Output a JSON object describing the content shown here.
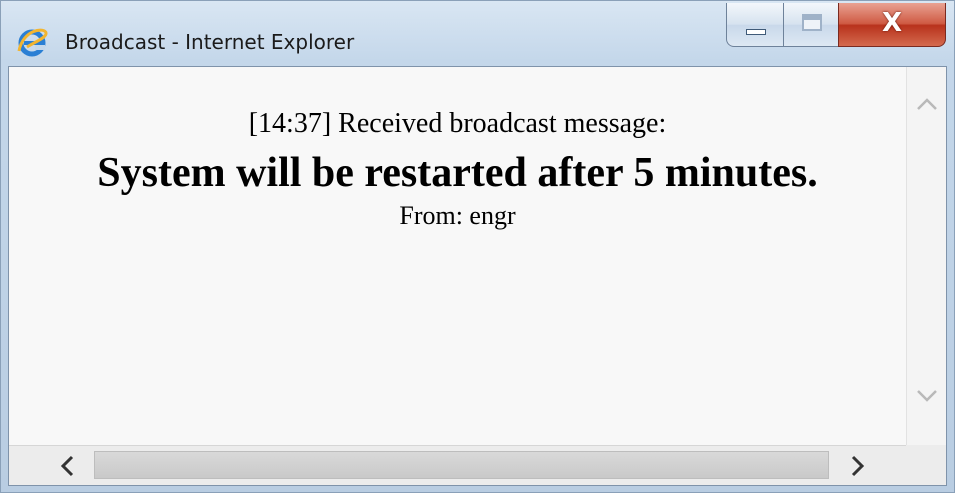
{
  "window": {
    "title": "Broadcast - Internet Explorer",
    "icon": "internet-explorer-icon",
    "caption_buttons": {
      "minimize_icon": "minimize-icon",
      "maximize_icon": "maximize-icon",
      "close_glyph": "X"
    }
  },
  "message": {
    "received_line": "[14:37] Received broadcast message:",
    "headline": "System will be restarted after 5 minutes.",
    "sender_line": "From: engr"
  },
  "scrollbars": {
    "up_arrow": "^",
    "down_arrow": "⌄",
    "left_arrow": "<",
    "right_arrow": ">"
  },
  "colors": {
    "close_button": "#c8442c",
    "title_bar": "#c4d7ea",
    "ie_logo": "#2a7fd4"
  }
}
